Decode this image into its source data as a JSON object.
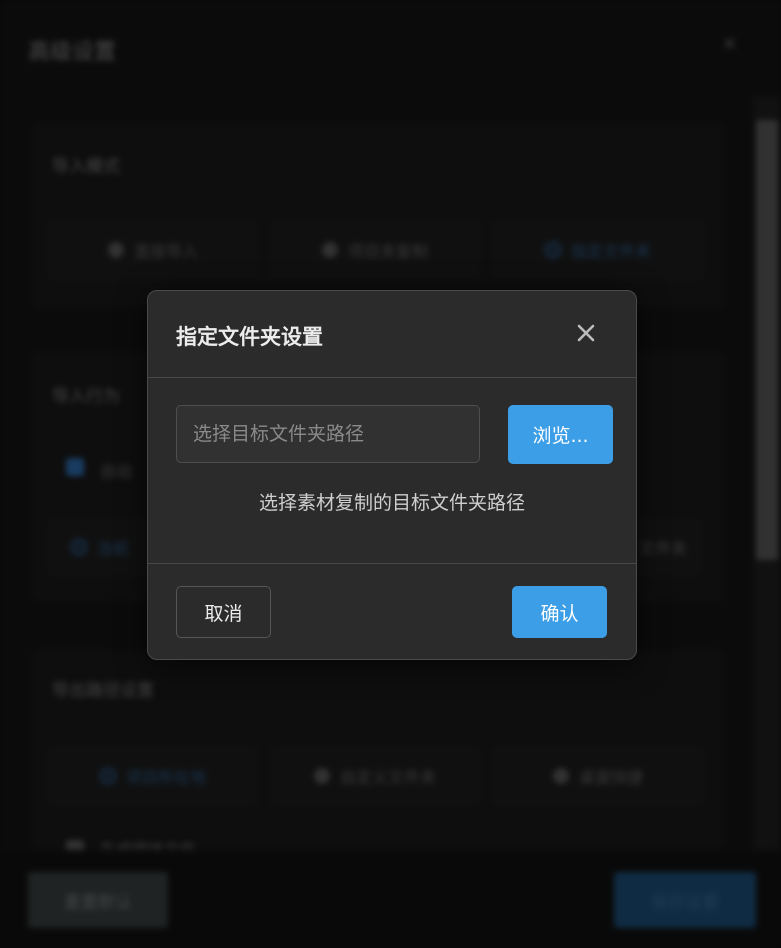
{
  "background": {
    "window_title": "高级设置",
    "close_icon": "close-icon",
    "section1_title": "导入模式",
    "section1_options": [
      "直接导入",
      "项目夹复制",
      "指定文件夹"
    ],
    "section2_title": "导入行为",
    "section2_checkbox_label": "自动",
    "section2_option_left": "当前",
    "section2_option_right": "文件夹",
    "section3_title": "导出路径设置",
    "section3_options": [
      "项目所在地",
      "自定义文件夹",
      "桌面快捷"
    ],
    "section3_checkbox_label": "生成媒体文件",
    "reset_button": "重置默认",
    "save_button": "保存设置"
  },
  "dialog": {
    "title": "指定文件夹设置",
    "close_icon": "close-icon",
    "path_input": {
      "value": "",
      "placeholder": "选择目标文件夹路径"
    },
    "browse_label": "浏览...",
    "hint": "选择素材复制的目标文件夹路径",
    "cancel_label": "取消",
    "confirm_label": "确认"
  },
  "colors": {
    "accent": "#3c9ee6",
    "dialog_bg": "#2b2b2b",
    "page_bg": "#101010"
  }
}
